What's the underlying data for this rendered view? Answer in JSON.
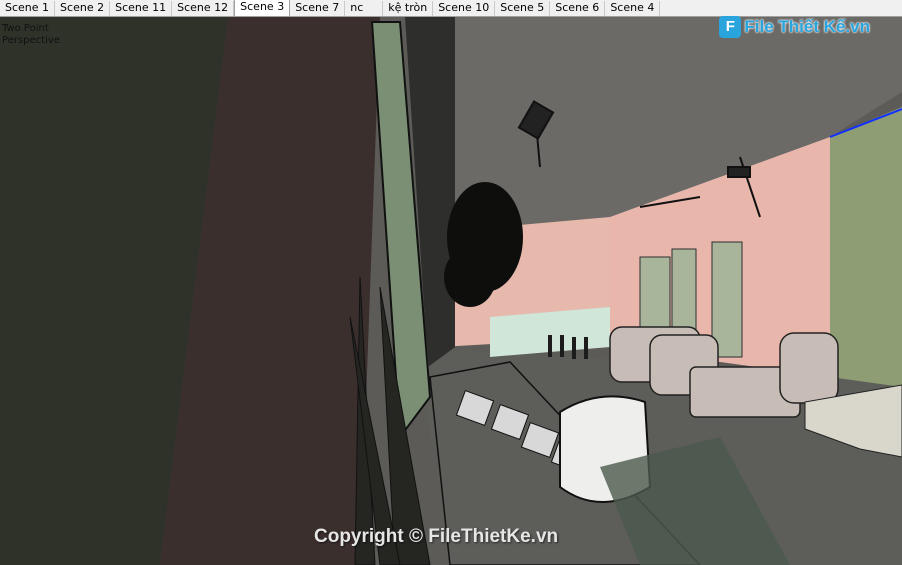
{
  "tabs": [
    {
      "label": "Scene 1",
      "active": false
    },
    {
      "label": "Scene 2",
      "active": false
    },
    {
      "label": "Scene 11",
      "active": false
    },
    {
      "label": "Scene 12",
      "active": false
    },
    {
      "label": "Scene 3",
      "active": true
    },
    {
      "label": "Scene 7",
      "active": false
    },
    {
      "label": "nc",
      "active": false
    },
    {
      "label": "kệ tròn",
      "active": false
    },
    {
      "label": "Scene 10",
      "active": false
    },
    {
      "label": "Scene 5",
      "active": false
    },
    {
      "label": "Scene 6",
      "active": false
    },
    {
      "label": "Scene 4",
      "active": false
    }
  ],
  "viewport": {
    "camera_line1": "Two Point",
    "camera_line2": "Perspective"
  },
  "watermark": {
    "logo_mark": "F",
    "logo_text": "File Thiết Kế.vn",
    "copyright": "Copyright © FileThietKe.vn"
  },
  "colors": {
    "pink_wall": "#e8b4a8",
    "green_panel": "#8fa07a",
    "selection_blue": "#1030ff",
    "curtain": "#3d3a36",
    "ceiling": "#6a6a68"
  }
}
